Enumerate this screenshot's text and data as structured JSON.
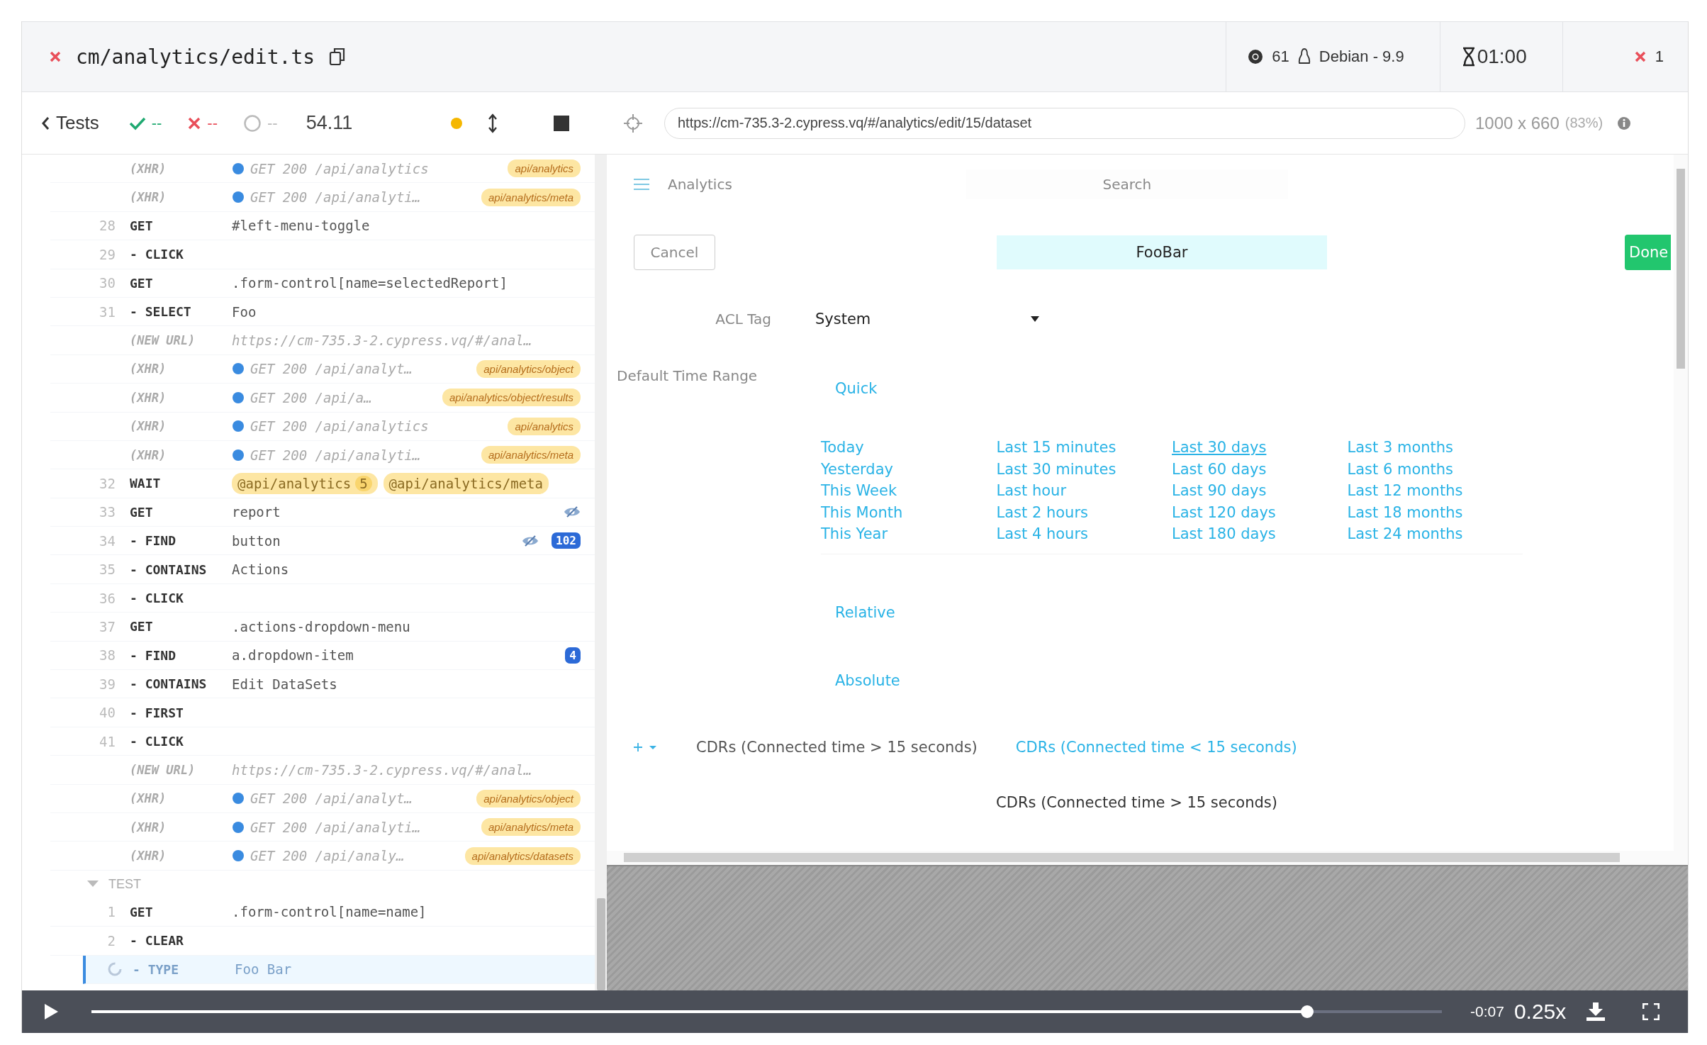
{
  "header": {
    "spec_file": "cm/analytics/edit.ts",
    "browser_version": "61",
    "os": "Debian - 9.9",
    "timer": "01:00",
    "failures": "1"
  },
  "toolbar": {
    "back": "Tests",
    "passed": "--",
    "failed": "--",
    "pending": "--",
    "duration": "54.11",
    "url": "https://cm-735.3-2.cypress.vq/#/analytics/edit/15/dataset",
    "viewport": "1000 x 660",
    "scale": "(83%)"
  },
  "commands": [
    {
      "kind": "event",
      "label": "(XHR)",
      "message": "GET 200 /api/analytics",
      "alias": "api/analytics"
    },
    {
      "kind": "event",
      "label": "(XHR)",
      "message": "GET 200 /api/analyti…",
      "alias": "api/analytics/meta"
    },
    {
      "kind": "command",
      "number": "28",
      "name": "GET",
      "message": "#left-menu-toggle"
    },
    {
      "kind": "command",
      "number": "29",
      "name": "- CLICK"
    },
    {
      "kind": "command",
      "number": "30",
      "name": "GET",
      "message": ".form-control[name=selectedReport]"
    },
    {
      "kind": "command",
      "number": "31",
      "name": "- SELECT",
      "message": "Foo"
    },
    {
      "kind": "url",
      "label": "(NEW URL)",
      "message": "https://cm-735.3-2.cypress.vq/#/anal…"
    },
    {
      "kind": "event",
      "label": "(XHR)",
      "message": "GET 200 /api/analyt…",
      "alias": "api/analytics/object"
    },
    {
      "kind": "event",
      "label": "(XHR)",
      "message": "GET 200 /api/a…",
      "alias": "api/analytics/object/results"
    },
    {
      "kind": "event",
      "label": "(XHR)",
      "message": "GET 200 /api/analytics",
      "alias": "api/analytics"
    },
    {
      "kind": "event",
      "label": "(XHR)",
      "message": "GET 200 /api/analyti…",
      "alias": "api/analytics/meta"
    },
    {
      "kind": "wait",
      "number": "32",
      "name": "WAIT",
      "aliases": [
        {
          "text": "@api/analytics",
          "count": "5"
        },
        {
          "text": "@api/analytics/meta"
        }
      ]
    },
    {
      "kind": "command",
      "number": "33",
      "name": "GET",
      "message": "report",
      "hidden": true
    },
    {
      "kind": "command",
      "number": "34",
      "name": "- FIND",
      "message": "button",
      "hidden": true,
      "count": "102"
    },
    {
      "kind": "command",
      "number": "35",
      "name": "- CONTAINS",
      "message": "Actions"
    },
    {
      "kind": "command",
      "number": "36",
      "name": "- CLICK"
    },
    {
      "kind": "command",
      "number": "37",
      "name": "GET",
      "message": ".actions-dropdown-menu"
    },
    {
      "kind": "command",
      "number": "38",
      "name": "- FIND",
      "message": "a.dropdown-item",
      "count": "4"
    },
    {
      "kind": "command",
      "number": "39",
      "name": "- CONTAINS",
      "message": "Edit DataSets"
    },
    {
      "kind": "command",
      "number": "40",
      "name": "- FIRST"
    },
    {
      "kind": "command",
      "number": "41",
      "name": "- CLICK"
    },
    {
      "kind": "url",
      "label": "(NEW URL)",
      "message": "https://cm-735.3-2.cypress.vq/#/anal…"
    },
    {
      "kind": "event",
      "label": "(XHR)",
      "message": "GET 200 /api/analyt…",
      "alias": "api/analytics/object"
    },
    {
      "kind": "event",
      "label": "(XHR)",
      "message": "GET 200 /api/analyti…",
      "alias": "api/analytics/meta"
    },
    {
      "kind": "event",
      "label": "(XHR)",
      "message": "GET 200 /api/analy…",
      "alias": "api/analytics/datasets"
    },
    {
      "kind": "section",
      "label": "TEST",
      "expanded": true
    },
    {
      "kind": "command",
      "number": "1",
      "name": "GET",
      "message": ".form-control[name=name]"
    },
    {
      "kind": "command",
      "number": "2",
      "name": "- CLEAR"
    },
    {
      "kind": "command",
      "name": "- TYPE",
      "message": "Foo Bar",
      "pending": true
    }
  ],
  "app": {
    "title": "Analytics",
    "search_placeholder": "Search",
    "cancel": "Cancel",
    "name_value": "FooBar",
    "done": "Done",
    "acl_label": "ACL Tag",
    "acl_value": "System",
    "range_label": "Default Time Range",
    "modes": [
      {
        "label": "Quick",
        "options": [
          [
            {
              "label": "Today",
              "selected": false
            },
            {
              "label": "Yesterday",
              "selected": false
            },
            {
              "label": "This Week",
              "selected": false
            },
            {
              "label": "This Month",
              "selected": false
            },
            {
              "label": "This Year",
              "selected": false
            }
          ],
          [
            {
              "label": "Last 15 minutes",
              "selected": false
            },
            {
              "label": "Last 30 minutes",
              "selected": false
            },
            {
              "label": "Last hour",
              "selected": false
            },
            {
              "label": "Last 2 hours",
              "selected": false
            },
            {
              "label": "Last 4 hours",
              "selected": false
            }
          ],
          [
            {
              "label": "Last 30 days",
              "selected": true
            },
            {
              "label": "Last 60 days",
              "selected": false
            },
            {
              "label": "Last 90 days",
              "selected": false
            },
            {
              "label": "Last 120 days",
              "selected": false
            },
            {
              "label": "Last 180 days",
              "selected": false
            }
          ],
          [
            {
              "label": "Last 3 months",
              "selected": false
            },
            {
              "label": "Last 6 months",
              "selected": false
            },
            {
              "label": "Last 12 months",
              "selected": false
            },
            {
              "label": "Last 18 months",
              "selected": false
            },
            {
              "label": "Last 24 months",
              "selected": false
            }
          ]
        ]
      },
      {
        "label": "Relative"
      },
      {
        "label": "Absolute"
      }
    ],
    "dataset_tabs": [
      {
        "label": "CDRs (Connected time > 15 seconds)",
        "selected": true
      },
      {
        "label": "CDRs (Connected time < 15 seconds)",
        "selected": false
      }
    ],
    "dataset_heading": "CDRs (Connected time > 15 seconds)"
  },
  "video": {
    "remaining": "-0:07",
    "speed": "0.25x",
    "level": 0.9
  }
}
